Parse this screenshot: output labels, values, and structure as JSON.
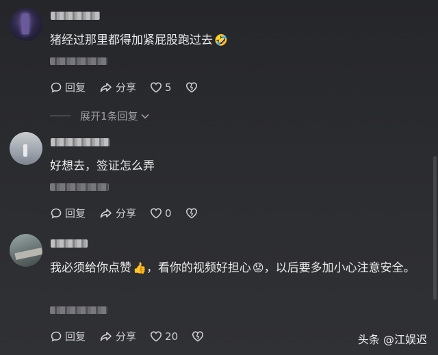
{
  "comments": [
    {
      "text": "猪经过那里都得加紧屁股跑过去",
      "emoji": "🤣",
      "reply_label": "回复",
      "share_label": "分享",
      "likes": "5",
      "expand_label": "展开1条回复"
    },
    {
      "text": "好想去，签证怎么弄",
      "reply_label": "回复",
      "share_label": "分享",
      "likes": "0"
    },
    {
      "text_part1": "我必须给你点赞",
      "emoji_like": "👍",
      "text_part2": "，看你的视频好担心",
      "emoji_worry": "😟",
      "text_part3": "，以后要多加小心注意安全。",
      "reply_label": "回复",
      "share_label": "分享",
      "likes": "20"
    }
  ],
  "watermark": "头条 @江娱迟",
  "icons": [
    "reply-icon",
    "share-icon",
    "like-heart-icon",
    "dislike-heart-icon",
    "chevron-down-icon"
  ]
}
